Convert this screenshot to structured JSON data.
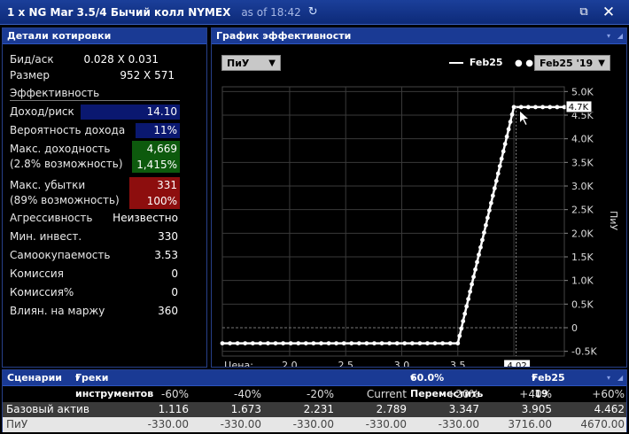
{
  "window": {
    "title": "1 x NG Mar 3.5/4 Бычий колл NYMEX",
    "as_of": "as of 18:42",
    "popout_glyph": "⧉",
    "close_glyph": "✕"
  },
  "quote_panel": {
    "header": "Детали котировки",
    "bid_ask_label": "Бид/аск",
    "bid_ask_value": "0.028 X 0.031",
    "size_label": "Размер",
    "size_value": "952 X 571",
    "section": "Эффективность",
    "rows": [
      {
        "label": "Доход/риск",
        "value": "14.10"
      },
      {
        "label": "Вероятность дохода",
        "value": "11%"
      },
      {
        "label": "Макс. доходность",
        "label2": "(2.8% возможность)",
        "value": "4,669",
        "value2": "1,415%"
      },
      {
        "label": "Макс. убытки",
        "label2": "(89% возможность)",
        "value": "331",
        "value2": "100%"
      },
      {
        "label": "Агрессивность",
        "value": "Неизвестно"
      },
      {
        "label": "Мин. инвест.",
        "value": "330"
      },
      {
        "label": "Самоокупаемость",
        "value": "3.53"
      },
      {
        "label": "Комиссия",
        "value": "0"
      },
      {
        "label": "Комиссия%",
        "value": "0"
      },
      {
        "label": "Влиян. на маржу",
        "value": "360"
      }
    ],
    "colors": {
      "ratio_bar": "#0a1870",
      "profit_box": "#0d5a0d",
      "loss_box": "#8d0e0e"
    }
  },
  "chart_panel": {
    "header": "График эффективности",
    "metric_dropdown": "ПиУ",
    "legend": [
      {
        "name": "Feb25",
        "style": "solid"
      },
      {
        "name": "Feb25 '19",
        "style": "dotted"
      }
    ],
    "cursor_x_label": "4.02",
    "cursor_y_label": "4.7K"
  },
  "chart_data": {
    "type": "line",
    "ylabel": "ПиУ",
    "xlabel": "Цена:",
    "xlim": [
      1.4,
      4.45
    ],
    "ylim": [
      -0.6,
      5.1
    ],
    "x_ticks": [
      "2.0",
      "2.5",
      "3.0",
      "3.5",
      "4.0"
    ],
    "x_tick_values": [
      2.0,
      2.5,
      3.0,
      3.5,
      4.0
    ],
    "y_ticks": [
      "5.0K",
      "4.5K",
      "4.0K",
      "3.5K",
      "3.0K",
      "2.5K",
      "2.0K",
      "1.5K",
      "1.0K",
      "0.5K",
      "0",
      "-0.5K"
    ],
    "y_tick_values": [
      5.0,
      4.5,
      4.0,
      3.5,
      3.0,
      2.5,
      2.0,
      1.5,
      1.0,
      0.5,
      0,
      -0.5
    ],
    "grid": true,
    "series": [
      {
        "name": "Feb25",
        "x": [
          1.4,
          3.5,
          4.0,
          4.45
        ],
        "y": [
          -0.33,
          -0.33,
          4.67,
          4.67
        ]
      },
      {
        "name": "Feb25 '19",
        "x": [
          1.4,
          3.5,
          4.0,
          4.45
        ],
        "y": [
          -0.33,
          -0.33,
          4.67,
          4.67
        ]
      }
    ],
    "y_units": "thousands"
  },
  "scenarios": {
    "header": "Сценарии",
    "greeks_dropdown": "Греки инструментов",
    "move_dropdown": "60.0% Переместить",
    "expiry_dropdown": "Feb25 '19",
    "columns": [
      "-60%",
      "-40%",
      "-20%",
      "Current",
      "+20%",
      "+40%",
      "+60%"
    ],
    "rows": [
      {
        "label": "Базовый актив",
        "values": [
          "1.116",
          "1.673",
          "2.231",
          "2.789",
          "3.347",
          "3.905",
          "4.462"
        ]
      },
      {
        "label": "ПиУ",
        "values": [
          "-330.00",
          "-330.00",
          "-330.00",
          "-330.00",
          "-330.00",
          "3716.00",
          "4670.00"
        ]
      }
    ]
  }
}
